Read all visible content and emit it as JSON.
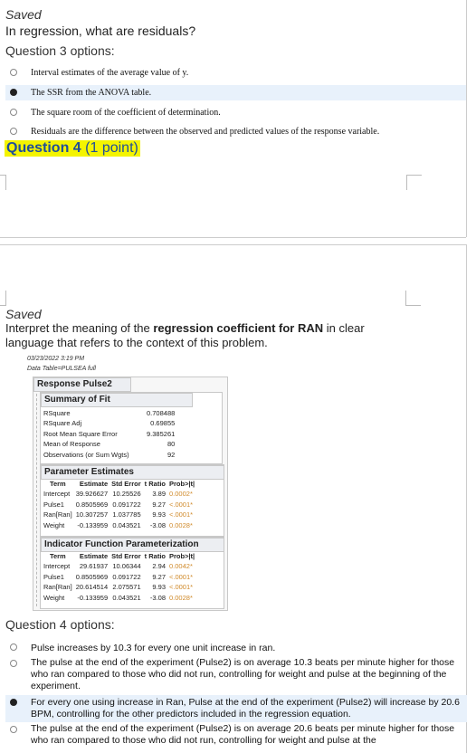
{
  "q3": {
    "saved": "Saved",
    "question": "In regression, what are residuals?",
    "options_title": "Question 3 options:",
    "options": [
      {
        "text": "Interval estimates of the average value of y.",
        "selected": false
      },
      {
        "text": "The SSR from the ANOVA table.",
        "selected": true
      },
      {
        "text": "The square room of the coefficient of determination.",
        "selected": false
      },
      {
        "text": "Residuals are the difference between the observed and predicted values of the response variable.",
        "selected": false
      }
    ]
  },
  "q4": {
    "heading": "Question 4",
    "points": "(1 point)",
    "saved": "Saved",
    "question_pre": "Interpret the meaning of the ",
    "question_bold": "regression coefficient for RAN",
    "question_post": " in clear language that refers to the context of this problem.",
    "options_title": "Question 4 options:",
    "options": [
      {
        "text": "Pulse increases by 10.3 for every one unit increase in ran.",
        "selected": false
      },
      {
        "text": "The pulse at the end of the experiment (Pulse2) is on average 10.3 beats per minute higher for those who ran compared to those who did not run, controlling for weight and pulse at the beginning of the experiment.",
        "selected": false
      },
      {
        "text": "For every one using increase in Ran, Pulse at the end of the experiment (Pulse2) will increase by 20.6 BPM, controlling for the other predictors included in the regression equation.",
        "selected": true
      },
      {
        "text": "The pulse at the end of the experiment (Pulse2) is on average 20.6 beats per minute higher for those who ran compared to those who did not run, controlling for weight and pulse at the",
        "selected": false
      }
    ]
  },
  "report": {
    "timestamp": "03/23/2022 3:19 PM",
    "datatable": "Data Table=PULSEA full",
    "response_title": "Response Pulse2",
    "summary_title": "Summary of Fit",
    "summary_rows": [
      {
        "label": "RSquare",
        "value": "0.708488"
      },
      {
        "label": "RSquare Adj",
        "value": "0.69855"
      },
      {
        "label": "Root Mean Square Error",
        "value": "9.385261"
      },
      {
        "label": "Mean of Response",
        "value": "80"
      },
      {
        "label": "Observations (or Sum Wgts)",
        "value": "92"
      }
    ],
    "pe_title": "Parameter Estimates",
    "pe_headers": [
      "Term",
      "Estimate",
      "Std Error",
      "t Ratio",
      "Prob>|t|"
    ],
    "pe_rows": [
      [
        "Intercept",
        "39.926627",
        "10.25526",
        "3.89",
        "0.0002*"
      ],
      [
        "Pulse1",
        "0.8505969",
        "0.091722",
        "9.27",
        "<.0001*"
      ],
      [
        "Ran[Ran]",
        "10.307257",
        "1.037785",
        "9.93",
        "<.0001*"
      ],
      [
        "Weight",
        "-0.133959",
        "0.043521",
        "-3.08",
        "0.0028*"
      ]
    ],
    "ifp_title": "Indicator Function Parameterization",
    "ifp_headers": [
      "Term",
      "Estimate",
      "Std Error",
      "t Ratio",
      "Prob>|t|"
    ],
    "ifp_rows": [
      [
        "Intercept",
        "29.61937",
        "10.06344",
        "2.94",
        "0.0042*"
      ],
      [
        "Pulse1",
        "0.8505969",
        "0.091722",
        "9.27",
        "<.0001*"
      ],
      [
        "Ran[Ran]",
        "20.614514",
        "2.075571",
        "9.93",
        "<.0001*"
      ],
      [
        "Weight",
        "-0.133959",
        "0.043521",
        "-3.08",
        "0.0028*"
      ]
    ]
  }
}
